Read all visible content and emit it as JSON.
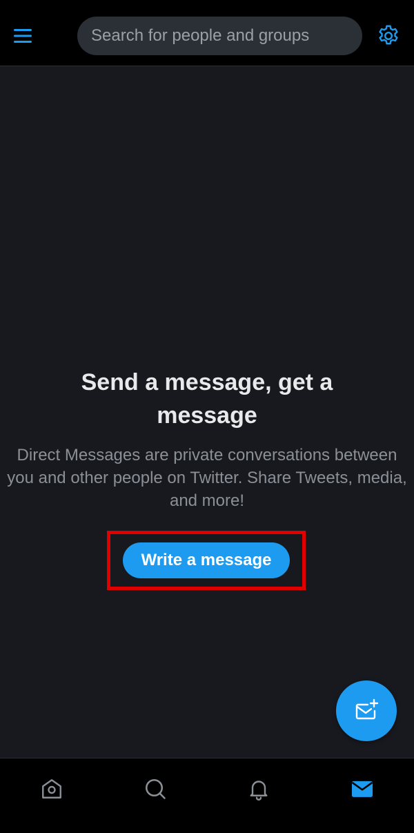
{
  "header": {
    "menu_icon": "hamburger-menu-icon",
    "search_placeholder": "Search for people and groups",
    "settings_icon": "gear-icon"
  },
  "empty_state": {
    "title": "Send a message, get a message",
    "description": "Direct Messages are private conversations between you and other people on Twitter. Share Tweets, media, and more!",
    "cta_label": "Write a message",
    "highlight_color": "#e00000"
  },
  "fab": {
    "icon": "new-message-icon"
  },
  "bottom_nav": {
    "items": [
      {
        "name": "home",
        "icon": "home-icon",
        "active": false
      },
      {
        "name": "search",
        "icon": "search-icon",
        "active": false
      },
      {
        "name": "notifications",
        "icon": "bell-icon",
        "active": false
      },
      {
        "name": "messages",
        "icon": "mail-icon",
        "active": true
      }
    ]
  },
  "colors": {
    "accent": "#1d9bf0",
    "background": "#17191e",
    "bar_background": "#000000",
    "inactive_icon": "#8b9097"
  }
}
